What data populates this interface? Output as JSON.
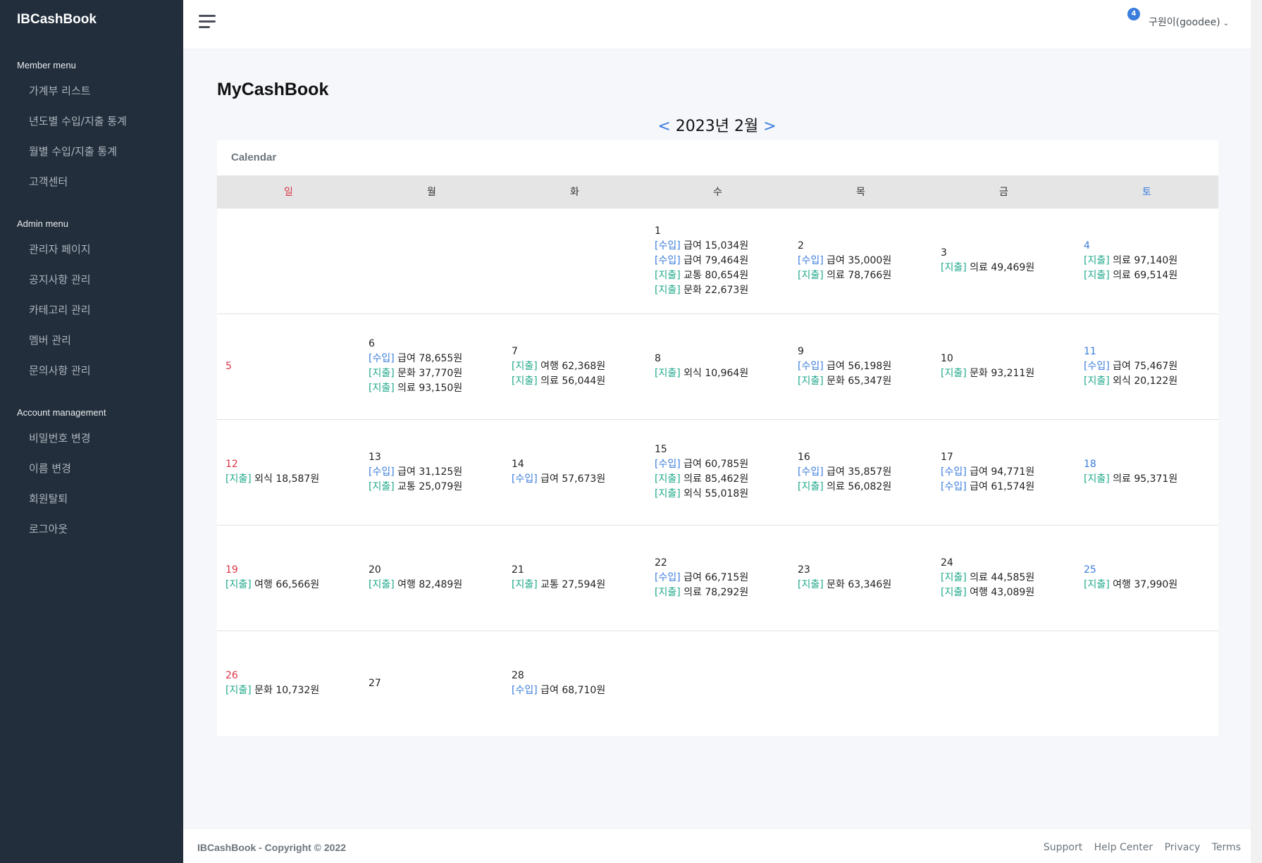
{
  "sidebar": {
    "brand": "IBCashBook",
    "groups": [
      {
        "header": "Member menu",
        "items": [
          "가계부 리스트",
          "년도별 수입/지출 통계",
          "월별 수입/지출 통계",
          "고객센터"
        ]
      },
      {
        "header": "Admin menu",
        "items": [
          "관리자 페이지",
          "공지사항 관리",
          "카테고리 관리",
          "멤버 관리",
          "문의사항 관리"
        ]
      },
      {
        "header": "Account management",
        "items": [
          "비밀번호 변경",
          "이름 변경",
          "회원탈퇴",
          "로그아웃"
        ]
      }
    ]
  },
  "topbar": {
    "notification_count": "4",
    "user_label": "구원이(goodee)",
    "chevron": "⌄"
  },
  "main": {
    "title": "MyCashBook",
    "prev": "<",
    "next": ">",
    "month_label": "2023년 2월",
    "card_title": "Calendar"
  },
  "calendar": {
    "weekdays": [
      "일",
      "월",
      "화",
      "수",
      "목",
      "금",
      "토"
    ],
    "weeks": [
      [
        null,
        null,
        null,
        {
          "day": "1",
          "entries": [
            [
              "[수입]",
              "급여 15,034원"
            ],
            [
              "[수입]",
              "급여 79,464원"
            ],
            [
              "[지출]",
              "교통 80,654원"
            ],
            [
              "[지출]",
              "문화 22,673원"
            ]
          ]
        },
        {
          "day": "2",
          "entries": [
            [
              "[수입]",
              "급여 35,000원"
            ],
            [
              "[지출]",
              "의료 78,766원"
            ]
          ]
        },
        {
          "day": "3",
          "entries": [
            [
              "[지출]",
              "의료 49,469원"
            ]
          ]
        },
        {
          "day": "4",
          "entries": [
            [
              "[지출]",
              "의료 97,140원"
            ],
            [
              "[지출]",
              "의료 69,514원"
            ]
          ]
        }
      ],
      [
        {
          "day": "5",
          "entries": []
        },
        {
          "day": "6",
          "entries": [
            [
              "[수입]",
              "급여 78,655원"
            ],
            [
              "[지출]",
              "문화 37,770원"
            ],
            [
              "[지출]",
              "의료 93,150원"
            ]
          ]
        },
        {
          "day": "7",
          "entries": [
            [
              "[지출]",
              "여행 62,368원"
            ],
            [
              "[지출]",
              "의료 56,044원"
            ]
          ]
        },
        {
          "day": "8",
          "entries": [
            [
              "[지출]",
              "외식 10,964원"
            ]
          ]
        },
        {
          "day": "9",
          "entries": [
            [
              "[수입]",
              "급여 56,198원"
            ],
            [
              "[지출]",
              "문화 65,347원"
            ]
          ]
        },
        {
          "day": "10",
          "entries": [
            [
              "[지출]",
              "문화 93,211원"
            ]
          ]
        },
        {
          "day": "11",
          "entries": [
            [
              "[수입]",
              "급여 75,467원"
            ],
            [
              "[지출]",
              "외식 20,122원"
            ]
          ]
        }
      ],
      [
        {
          "day": "12",
          "entries": [
            [
              "[지출]",
              "외식 18,587원"
            ]
          ]
        },
        {
          "day": "13",
          "entries": [
            [
              "[수입]",
              "급여 31,125원"
            ],
            [
              "[지출]",
              "교통 25,079원"
            ]
          ]
        },
        {
          "day": "14",
          "entries": [
            [
              "[수입]",
              "급여 57,673원"
            ]
          ]
        },
        {
          "day": "15",
          "entries": [
            [
              "[수입]",
              "급여 60,785원"
            ],
            [
              "[지출]",
              "의료 85,462원"
            ],
            [
              "[지출]",
              "외식 55,018원"
            ]
          ]
        },
        {
          "day": "16",
          "entries": [
            [
              "[수입]",
              "급여 35,857원"
            ],
            [
              "[지출]",
              "의료 56,082원"
            ]
          ]
        },
        {
          "day": "17",
          "entries": [
            [
              "[수입]",
              "급여 94,771원"
            ],
            [
              "[수입]",
              "급여 61,574원"
            ]
          ]
        },
        {
          "day": "18",
          "entries": [
            [
              "[지출]",
              "의료 95,371원"
            ]
          ]
        }
      ],
      [
        {
          "day": "19",
          "entries": [
            [
              "[지출]",
              "여행 66,566원"
            ]
          ]
        },
        {
          "day": "20",
          "entries": [
            [
              "[지출]",
              "여행 82,489원"
            ]
          ]
        },
        {
          "day": "21",
          "entries": [
            [
              "[지출]",
              "교통 27,594원"
            ]
          ]
        },
        {
          "day": "22",
          "entries": [
            [
              "[수입]",
              "급여 66,715원"
            ],
            [
              "[지출]",
              "의료 78,292원"
            ]
          ]
        },
        {
          "day": "23",
          "entries": [
            [
              "[지출]",
              "문화 63,346원"
            ]
          ]
        },
        {
          "day": "24",
          "entries": [
            [
              "[지출]",
              "의료 44,585원"
            ],
            [
              "[지출]",
              "여행 43,089원"
            ]
          ]
        },
        {
          "day": "25",
          "entries": [
            [
              "[지출]",
              "여행 37,990원"
            ]
          ]
        }
      ],
      [
        {
          "day": "26",
          "entries": [
            [
              "[지출]",
              "문화 10,732원"
            ]
          ]
        },
        {
          "day": "27",
          "entries": []
        },
        {
          "day": "28",
          "entries": [
            [
              "[수입]",
              "급여 68,710원"
            ]
          ]
        },
        null,
        null,
        null,
        null
      ]
    ]
  },
  "footer": {
    "copyright": "IBCashBook - Copyright © 2022",
    "links": [
      "Support",
      "Help Center",
      "Privacy",
      "Terms"
    ]
  },
  "colors": {
    "sidebar_bg": "#222e3c",
    "accent_blue": "#3b7ddd",
    "income_tag": "#3b7ddd",
    "expense_tag": "#20a98b",
    "sunday": "#dc3545"
  },
  "icons": {
    "menu": "hamburger-icon",
    "dropdown": "chevron-down-icon"
  }
}
